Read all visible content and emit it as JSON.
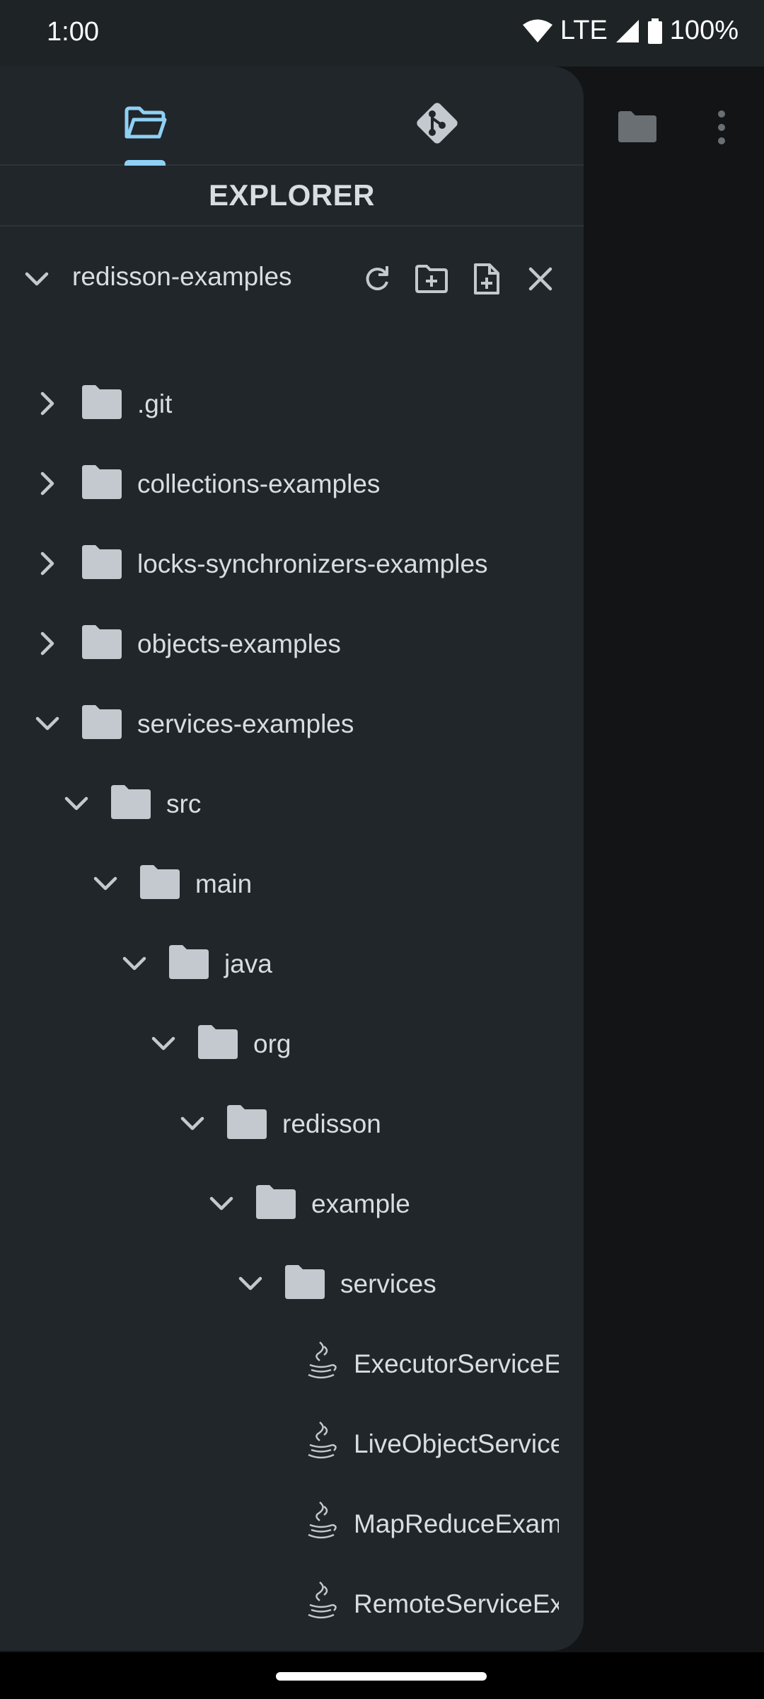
{
  "status_bar": {
    "time": "1:00",
    "network": "LTE",
    "battery": "100%"
  },
  "drawer": {
    "tabs": [
      {
        "name": "explorer",
        "icon": "folder-open-icon",
        "active": true
      },
      {
        "name": "git",
        "icon": "git-icon",
        "active": false
      }
    ],
    "title": "EXPLORER",
    "project": {
      "name": "redisson-examples",
      "actions": [
        "refresh-icon",
        "new-folder-icon",
        "new-file-icon",
        "close-icon"
      ]
    },
    "tree": [
      {
        "label": ".git",
        "type": "folder",
        "expanded": false,
        "depth": 0
      },
      {
        "label": "collections-examples",
        "type": "folder",
        "expanded": false,
        "depth": 0
      },
      {
        "label": "locks-synchronizers-examples",
        "type": "folder",
        "expanded": false,
        "depth": 0
      },
      {
        "label": "objects-examples",
        "type": "folder",
        "expanded": false,
        "depth": 0
      },
      {
        "label": "services-examples",
        "type": "folder",
        "expanded": true,
        "depth": 0
      },
      {
        "label": "src",
        "type": "folder",
        "expanded": true,
        "depth": 1
      },
      {
        "label": "main",
        "type": "folder",
        "expanded": true,
        "depth": 2
      },
      {
        "label": "java",
        "type": "folder",
        "expanded": true,
        "depth": 3
      },
      {
        "label": "org",
        "type": "folder",
        "expanded": true,
        "depth": 4
      },
      {
        "label": "redisson",
        "type": "folder",
        "expanded": true,
        "depth": 5
      },
      {
        "label": "example",
        "type": "folder",
        "expanded": true,
        "depth": 6
      },
      {
        "label": "services",
        "type": "folder",
        "expanded": true,
        "depth": 7
      },
      {
        "label": "ExecutorServiceExamples.java",
        "type": "java-file",
        "depth": 8
      },
      {
        "label": "LiveObjectServiceExamples.java",
        "type": "java-file",
        "depth": 8
      },
      {
        "label": "MapReduceExamples.java",
        "type": "java-file",
        "depth": 8
      },
      {
        "label": "RemoteServiceExamples.java",
        "type": "java-file",
        "depth": 8
      }
    ]
  },
  "editor": {
    "actions": [
      "folder-icon",
      "more-vert-icon"
    ]
  },
  "colors": {
    "accent": "#8fd0f5",
    "drawer_bg": "#20262a",
    "text": "#d8dde1",
    "folder": "#c3c9ce"
  }
}
